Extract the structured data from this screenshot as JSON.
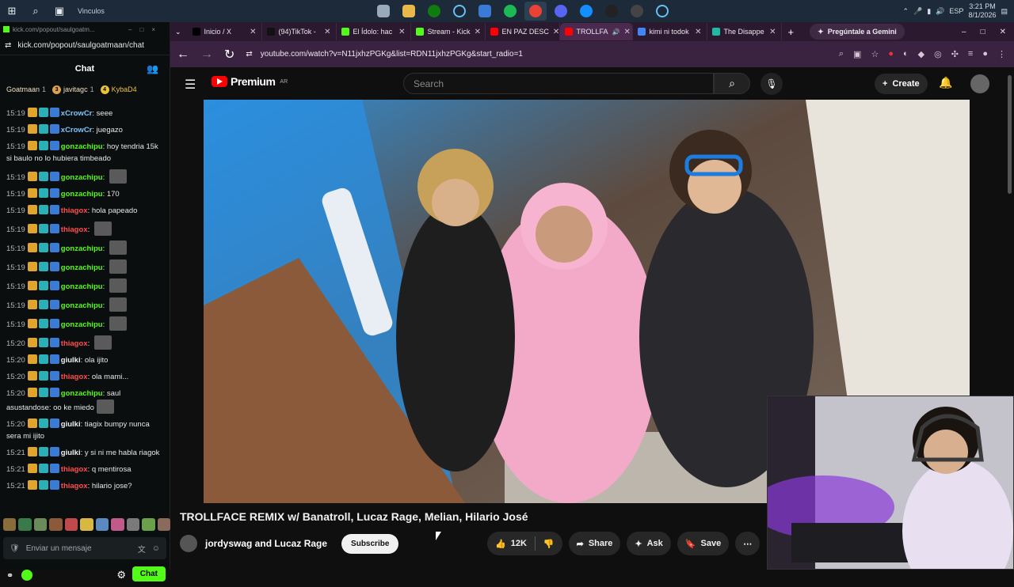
{
  "taskbar": {
    "window_title": "Vinculos",
    "time": "3:21 PM",
    "date": "8/1/2026",
    "lang": "ESP"
  },
  "kick": {
    "titlebar": "kick.com/popout/saulgoatm...",
    "url": "kick.com/popout/saulgoatmaan/chat",
    "chat_title": "Chat",
    "chips": [
      {
        "name": "Goatmaan",
        "count": "1",
        "num": ""
      },
      {
        "name": "javitagc",
        "count": "1",
        "num": "3"
      },
      {
        "name": "KybaD4",
        "count": "",
        "num": "4"
      }
    ],
    "messages": [
      {
        "time": "15:19",
        "user": "xCrowCr",
        "color": "u-blue",
        "text": "seee",
        "emote": false
      },
      {
        "time": "15:19",
        "user": "xCrowCr",
        "color": "u-blue",
        "text": "juegazo",
        "emote": false
      },
      {
        "time": "15:19",
        "user": "gonzachipu",
        "color": "u-green",
        "text": "hoy tendria 15k si baulo no lo hubiera timbeado",
        "emote": false
      },
      {
        "time": "15:19",
        "user": "gonzachipu",
        "color": "u-green",
        "text": "",
        "emote": true
      },
      {
        "time": "15:19",
        "user": "gonzachipu",
        "color": "u-green",
        "text": "170",
        "emote": false
      },
      {
        "time": "15:19",
        "user": "thiagox",
        "color": "u-red",
        "text": "hola papeado",
        "emote": false
      },
      {
        "time": "15:19",
        "user": "thiagox",
        "color": "u-red",
        "text": "",
        "emote": true
      },
      {
        "time": "15:19",
        "user": "gonzachipu",
        "color": "u-green",
        "text": "",
        "emote": true
      },
      {
        "time": "15:19",
        "user": "gonzachipu",
        "color": "u-green",
        "text": "",
        "emote": true
      },
      {
        "time": "15:19",
        "user": "gonzachipu",
        "color": "u-green",
        "text": "",
        "emote": true
      },
      {
        "time": "15:19",
        "user": "gonzachipu",
        "color": "u-green",
        "text": "",
        "emote": true
      },
      {
        "time": "15:19",
        "user": "gonzachipu",
        "color": "u-green",
        "text": "",
        "emote": true
      },
      {
        "time": "15:20",
        "user": "thiagox",
        "color": "u-red",
        "text": "",
        "emote": true
      },
      {
        "time": "15:20",
        "user": "giulki",
        "color": "u-white",
        "text": "ola ijito",
        "emote": false
      },
      {
        "time": "15:20",
        "user": "thiagox",
        "color": "u-red",
        "text": "ola mami...",
        "emote": false
      },
      {
        "time": "15:20",
        "user": "gonzachipu",
        "color": "u-green",
        "text": "saul asustandose: oo ke miedo",
        "emote": true
      },
      {
        "time": "15:20",
        "user": "giulki",
        "color": "u-white",
        "text": "tiagix bumpy nunca sera mi ijito",
        "emote": false
      },
      {
        "time": "15:21",
        "user": "giulki",
        "color": "u-white",
        "text": "y si ni me habla riagok",
        "emote": false
      },
      {
        "time": "15:21",
        "user": "thiagox",
        "color": "u-red",
        "text": "q mentirosa",
        "emote": false
      },
      {
        "time": "15:21",
        "user": "thiagox",
        "color": "u-red",
        "text": "hilario jose?",
        "emote": false
      }
    ],
    "input_placeholder": "Enviar un mensaje",
    "chat_button": "Chat"
  },
  "browser": {
    "tabs": [
      {
        "label": "Inicio / X",
        "color": "#000000",
        "active": false
      },
      {
        "label": "(94)TikTok - ",
        "color": "#111111",
        "active": false
      },
      {
        "label": "El Ídolo: hac",
        "color": "#53fc18",
        "active": false
      },
      {
        "label": "Stream - Kick",
        "color": "#53fc18",
        "active": false
      },
      {
        "label": "EN PAZ DESC",
        "color": "#ff0000",
        "active": false
      },
      {
        "label": "TROLLFA",
        "color": "#ff0000",
        "active": true
      },
      {
        "label": "kimi ni todok",
        "color": "#4285f4",
        "active": false
      },
      {
        "label": "The Disappe",
        "color": "#1db9a4",
        "active": false
      }
    ],
    "gemini": "Pregúntale a Gemini",
    "url": "youtube.com/watch?v=N11jxhzPGKg&list=RDN11jxhzPGKg&start_radio=1"
  },
  "youtube": {
    "logo": "Premium",
    "region": "AR",
    "search_placeholder": "Search",
    "create": "Create",
    "title": "TROLLFACE REMIX w/ Banatroll, Lucaz Rage, Melian, Hilario José",
    "channel": "jordyswag and Lucaz Rage",
    "subscribe": "Subscribe",
    "likes": "12K",
    "share": "Share",
    "ask": "Ask",
    "save": "Save"
  }
}
